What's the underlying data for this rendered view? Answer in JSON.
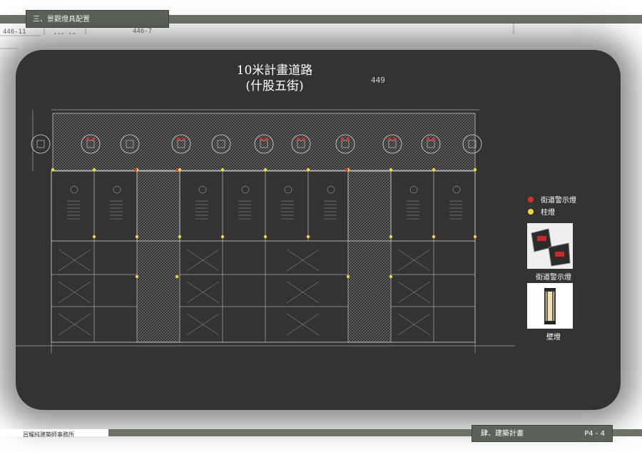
{
  "header": {
    "section_title": "三、景觀燈具配置"
  },
  "background": {
    "lot_labels": [
      "446-11",
      "446-12",
      "446-7"
    ]
  },
  "plan": {
    "road_title_line1": "10米計畫道路",
    "road_title_line2": "(什股五街)",
    "lot_number": "449"
  },
  "legend": {
    "items": [
      {
        "label": "街道警示燈",
        "color": "#d9342b"
      },
      {
        "label": "柱燈",
        "color": "#f2d73b"
      }
    ],
    "photos": [
      {
        "caption": "街道警示燈",
        "icon": "road-warning-light-icon"
      },
      {
        "caption": "壁燈",
        "icon": "wall-lamp-icon"
      }
    ]
  },
  "footer": {
    "company": "呂耀純建築師事務所",
    "chapter": "肆、建築計畫",
    "page": "P4 - 4"
  },
  "colors": {
    "band": "#6c7366",
    "tab": "#5b6356",
    "panel": "#333333"
  }
}
